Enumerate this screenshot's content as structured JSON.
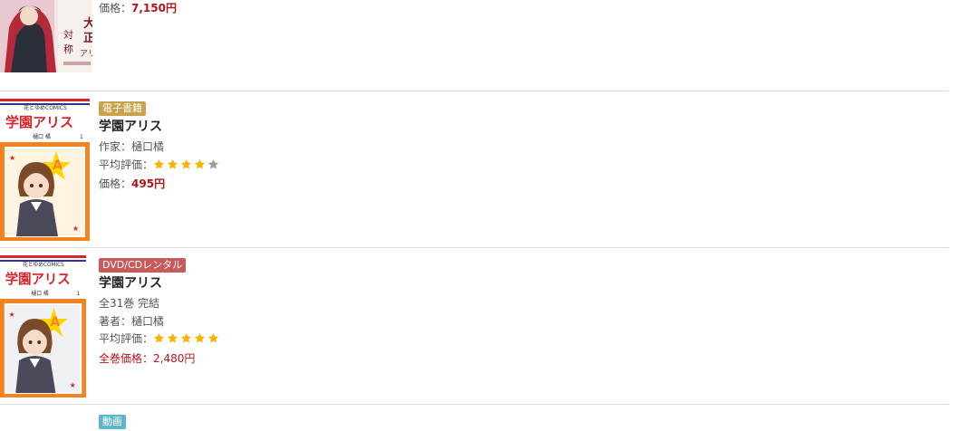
{
  "items": [
    {
      "badge": "",
      "title": "",
      "lines": [],
      "price_label": "価格：",
      "price_value": "7,150円",
      "cover_title": "大正対称アリス"
    },
    {
      "badge": "電子書籍",
      "badge_color": "#c9a24a",
      "title": "学園アリス",
      "author_line": "作家：樋口橘",
      "rating_label": "平均評価：",
      "rating": 4,
      "price_label": "価格：",
      "price_value": "495円",
      "cover_title": "学園アリス",
      "cover_imprint": "花とゆめCOMICS",
      "cover_author": "樋口 橘",
      "cover_volume": "1"
    },
    {
      "badge": "DVD/CDレンタル",
      "badge_color": "#c85a5a",
      "title": "学園アリス",
      "volumes_line": "全31巻 完結",
      "author_line": "著者：樋口橘",
      "rating_label": "平均評価：",
      "rating": 5,
      "total_price_line": "全巻価格：2,480円",
      "cover_title": "学園アリス",
      "cover_imprint": "花とゆめCOMICS",
      "cover_author": "樋口 橘",
      "cover_volume": "1"
    },
    {
      "badge": "動画",
      "badge_color": "#5bb7c8"
    }
  ],
  "colors": {
    "star_on": "#f5b400",
    "star_off": "#9a9a9a",
    "price": "#b0141b"
  }
}
